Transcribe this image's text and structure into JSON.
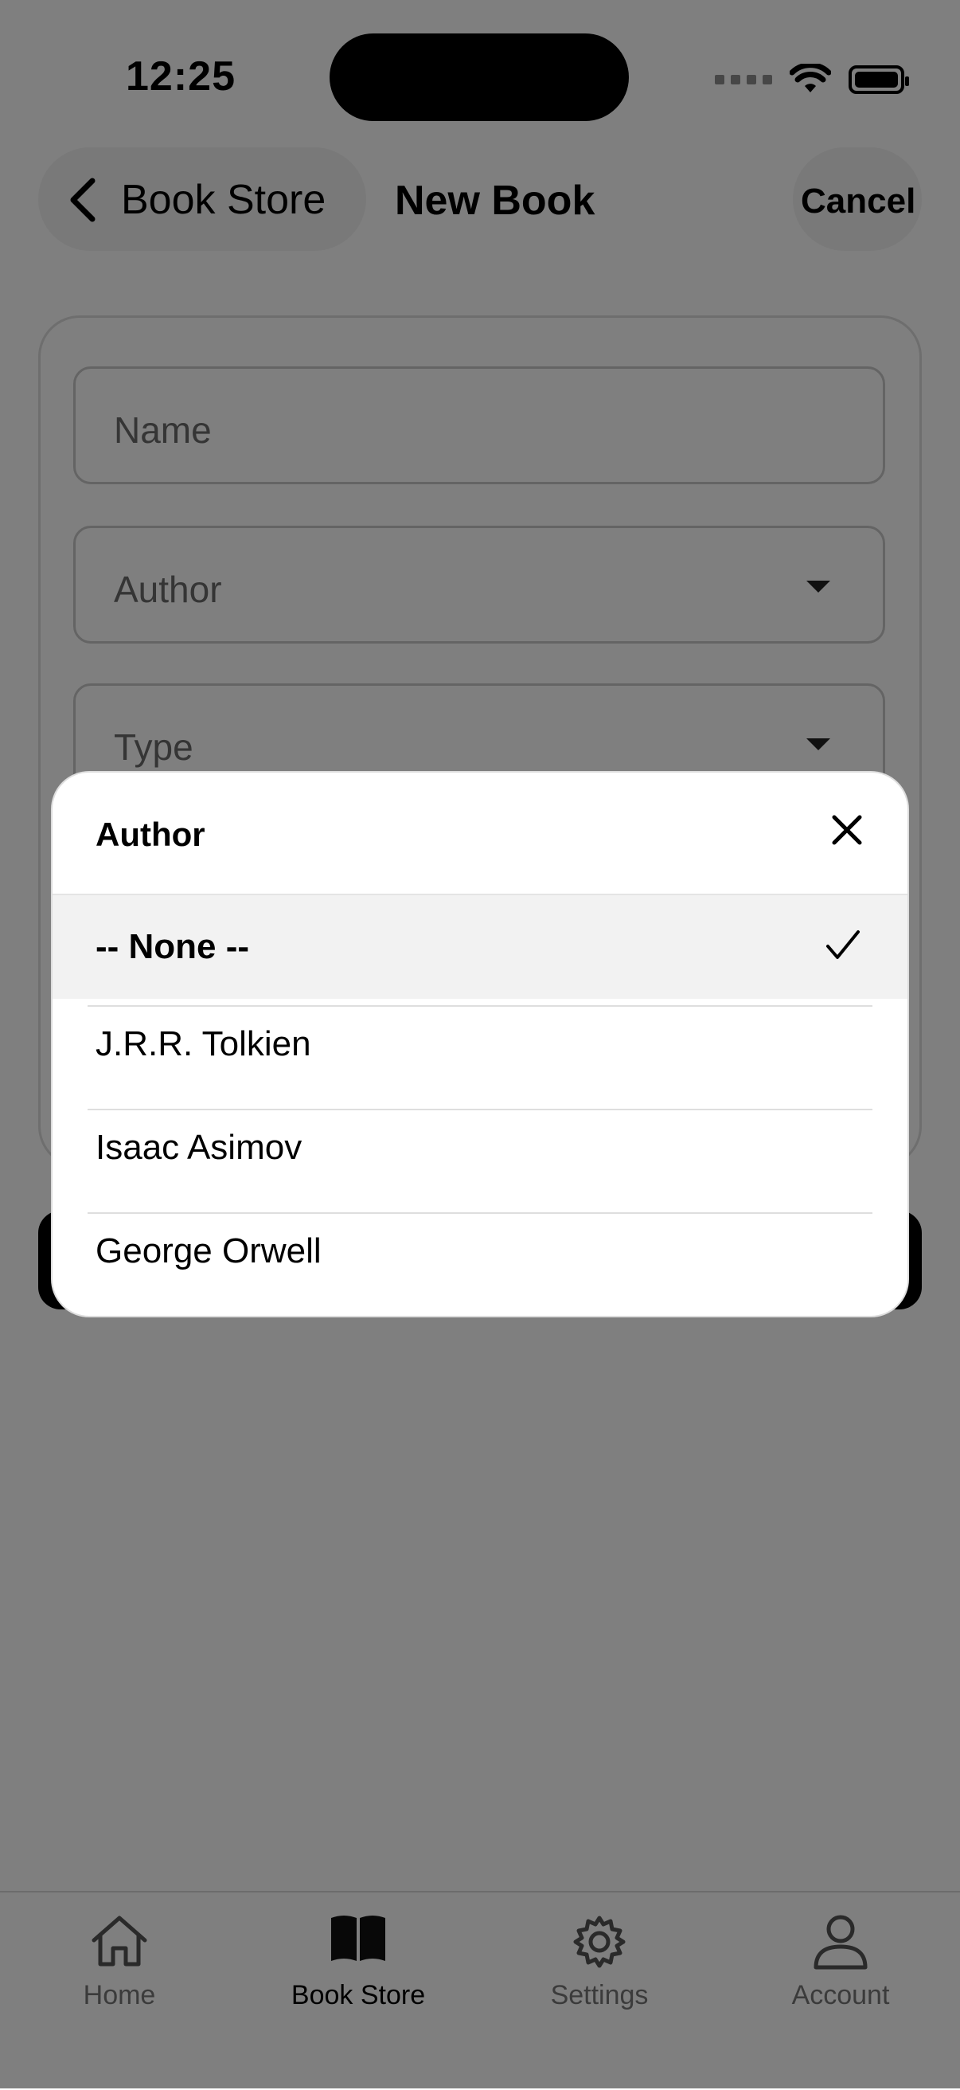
{
  "status_bar": {
    "time": "12:25",
    "icons": [
      "cellular-dots-icon",
      "wifi-icon",
      "battery-icon"
    ]
  },
  "nav": {
    "back_label": "Book Store",
    "title": "New Book",
    "cancel_label": "Cancel"
  },
  "form": {
    "name_placeholder": "Name",
    "author_placeholder": "Author",
    "type_placeholder": "Type"
  },
  "picker": {
    "title": "Author",
    "options": [
      {
        "label": "-- None --",
        "selected": true
      },
      {
        "label": "J.R.R. Tolkien",
        "selected": false
      },
      {
        "label": "Isaac Asimov",
        "selected": false
      },
      {
        "label": "George Orwell",
        "selected": false
      }
    ]
  },
  "tabbar": {
    "items": [
      {
        "label": "Home",
        "icon": "home-icon",
        "active": false
      },
      {
        "label": "Book Store",
        "icon": "book-icon",
        "active": true
      },
      {
        "label": "Settings",
        "icon": "gear-icon",
        "active": false
      },
      {
        "label": "Account",
        "icon": "person-icon",
        "active": false
      }
    ]
  },
  "colors": {
    "scrim": "#000000",
    "primary": "#000000",
    "selected_row": "#f2f2f2"
  }
}
